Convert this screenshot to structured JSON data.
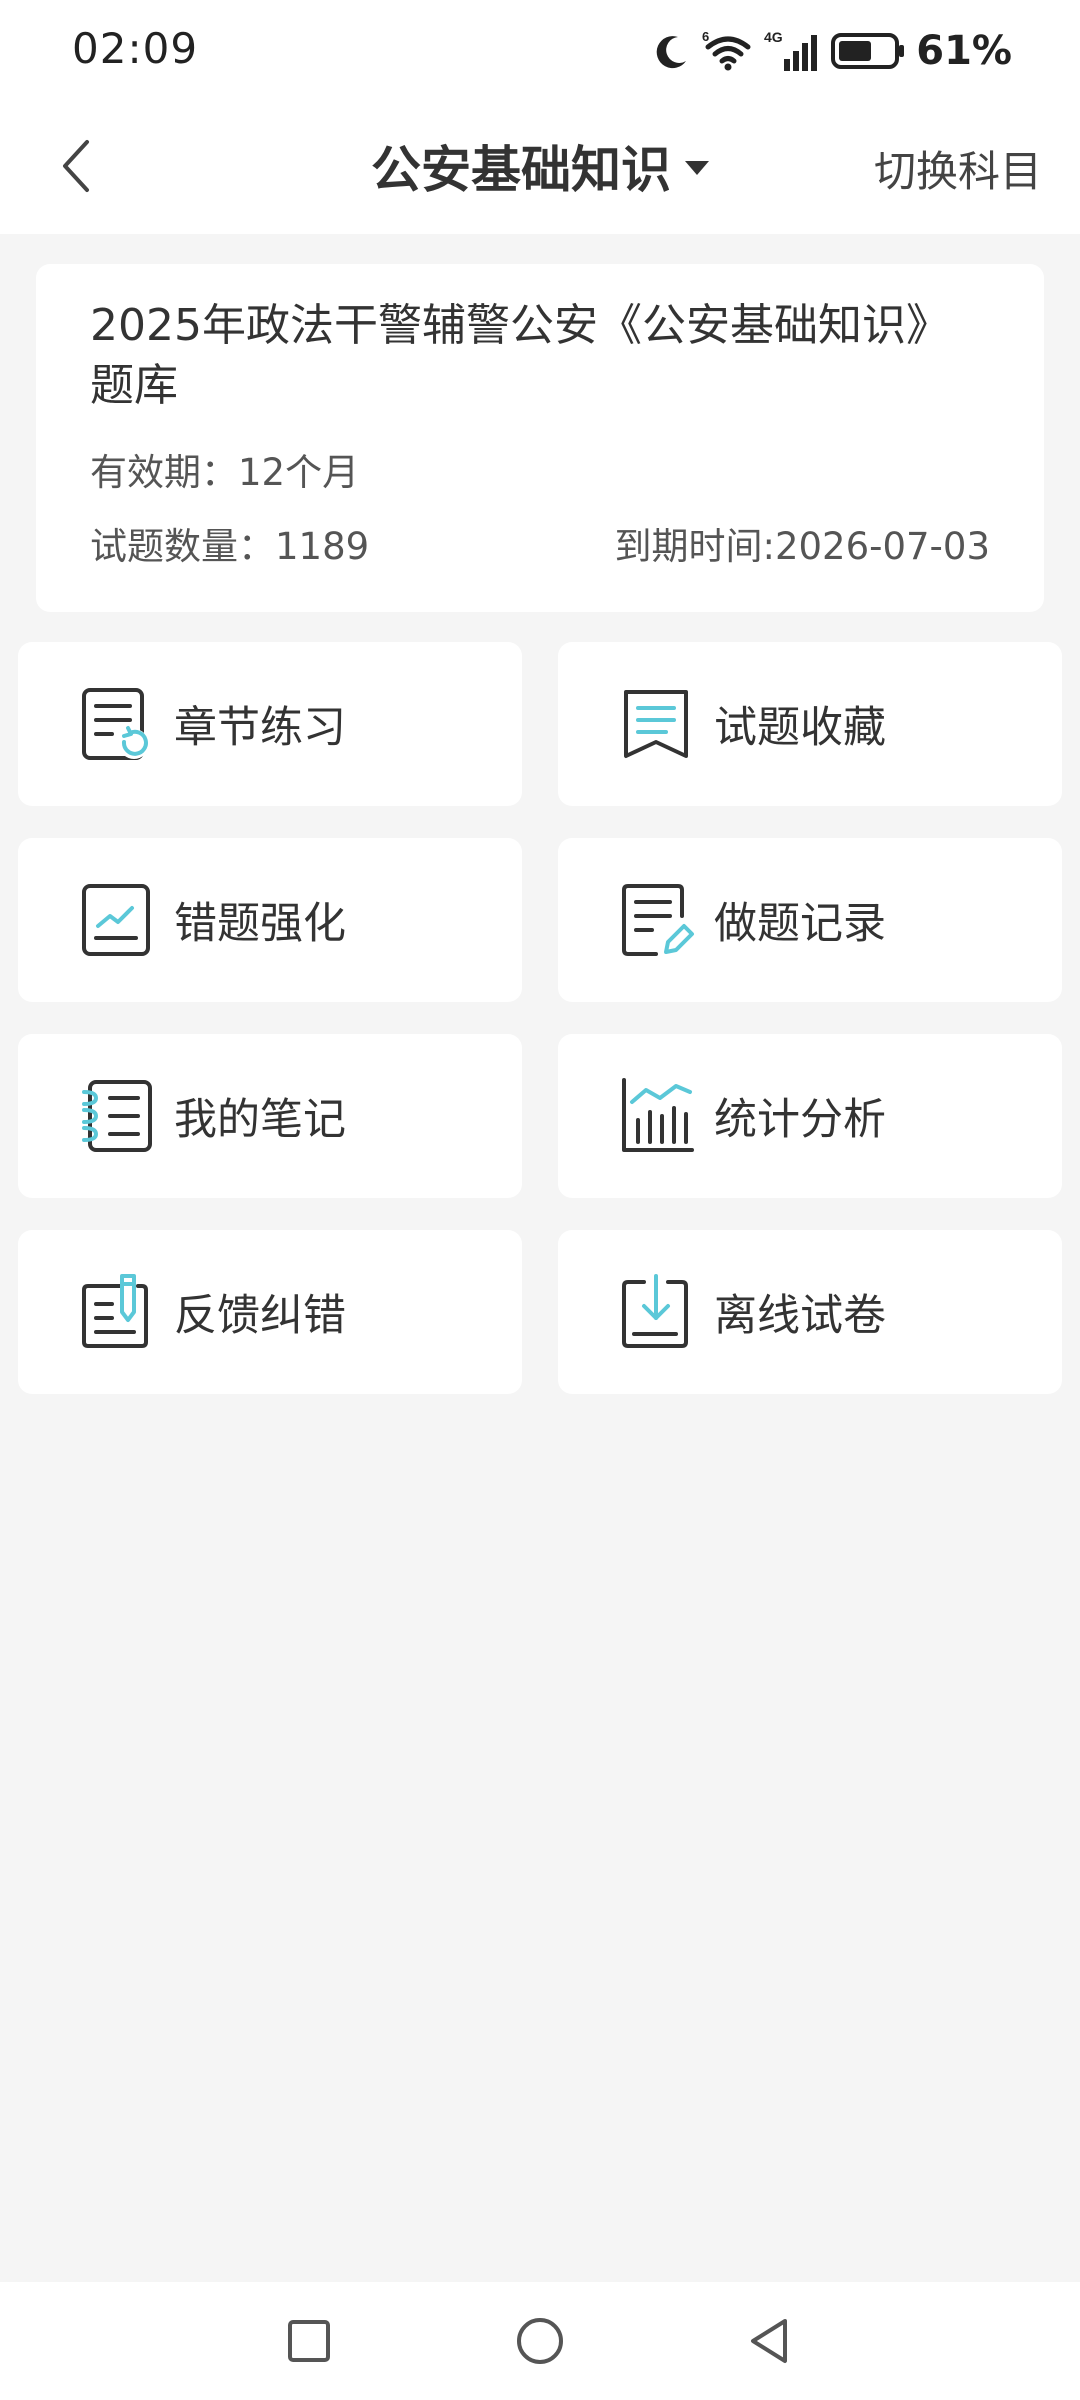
{
  "status_bar": {
    "time": "02:09",
    "network_label": "4G",
    "wifi_label": "6",
    "battery_percent": "61%",
    "battery_level": 0.61,
    "icons": [
      "moon-icon",
      "wifi-icon",
      "signal-icon",
      "battery-icon"
    ]
  },
  "nav": {
    "title": "公安基础知识",
    "switch_label": "切换科目",
    "back_icon": "chevron-left-icon",
    "dropdown_icon": "caret-down-icon"
  },
  "info_card": {
    "title": "2025年政法干警辅警公安《公安基础知识》题库",
    "validity": "有效期：12个月",
    "question_count": "试题数量：1189",
    "expire_date": "到期时间:2026-07-03"
  },
  "menu": [
    {
      "label": "章节练习",
      "icon": "chapter-practice-icon"
    },
    {
      "label": "试题收藏",
      "icon": "bookmark-icon"
    },
    {
      "label": "错题强化",
      "icon": "wrong-question-chart-icon"
    },
    {
      "label": "做题记录",
      "icon": "record-edit-icon"
    },
    {
      "label": "我的笔记",
      "icon": "notebook-icon"
    },
    {
      "label": "统计分析",
      "icon": "bar-chart-icon"
    },
    {
      "label": "反馈纠错",
      "icon": "feedback-pen-icon"
    },
    {
      "label": "离线试卷",
      "icon": "download-icon"
    }
  ],
  "colors": {
    "accent": "#5bc8d8",
    "icon_dark": "#333333",
    "background": "#f5f5f5",
    "card": "#ffffff"
  },
  "system_nav": [
    "recent-apps-square-icon",
    "home-circle-icon",
    "back-triangle-icon"
  ]
}
